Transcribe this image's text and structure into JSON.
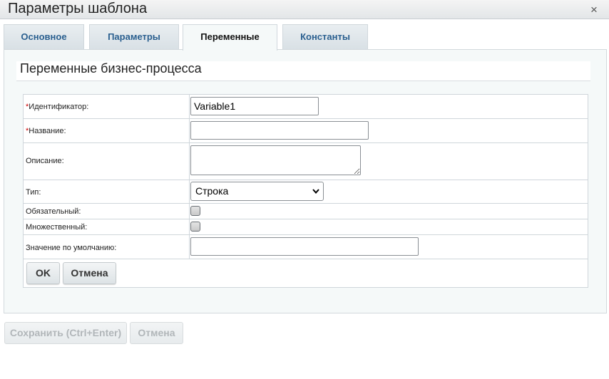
{
  "dialog": {
    "title": "Параметры шаблона",
    "close_glyph": "×"
  },
  "tabs": [
    {
      "label": "Основное",
      "active": false
    },
    {
      "label": "Параметры",
      "active": false
    },
    {
      "label": "Переменные",
      "active": true
    },
    {
      "label": "Константы",
      "active": false
    }
  ],
  "section": {
    "heading": "Переменные бизнес-процесса"
  },
  "form": {
    "required_mark": "*",
    "identifier": {
      "label": "Идентификатор:",
      "value": "Variable1",
      "required": true
    },
    "name": {
      "label": "Название:",
      "value": "",
      "required": true
    },
    "description": {
      "label": "Описание:",
      "value": ""
    },
    "type": {
      "label": "Тип:",
      "selected": "Строка"
    },
    "required_field": {
      "label": "Обязательный:",
      "checked": false
    },
    "multiple": {
      "label": "Множественный:",
      "checked": false
    },
    "default_value": {
      "label": "Значение по умолчанию:",
      "value": ""
    },
    "ok_label": "OK",
    "cancel_label": "Отмена"
  },
  "footer": {
    "save_label": "Сохранить (Ctrl+Enter)",
    "cancel_label": "Отмена"
  },
  "icons": {
    "close": "close-icon",
    "select_arrow": "chevron-down-icon",
    "textarea_resize": "resize-grip-icon"
  },
  "colors": {
    "tab_text": "#2a5f8f",
    "required_mark": "#cc0000",
    "panel_bg": "#f5f9f9"
  }
}
